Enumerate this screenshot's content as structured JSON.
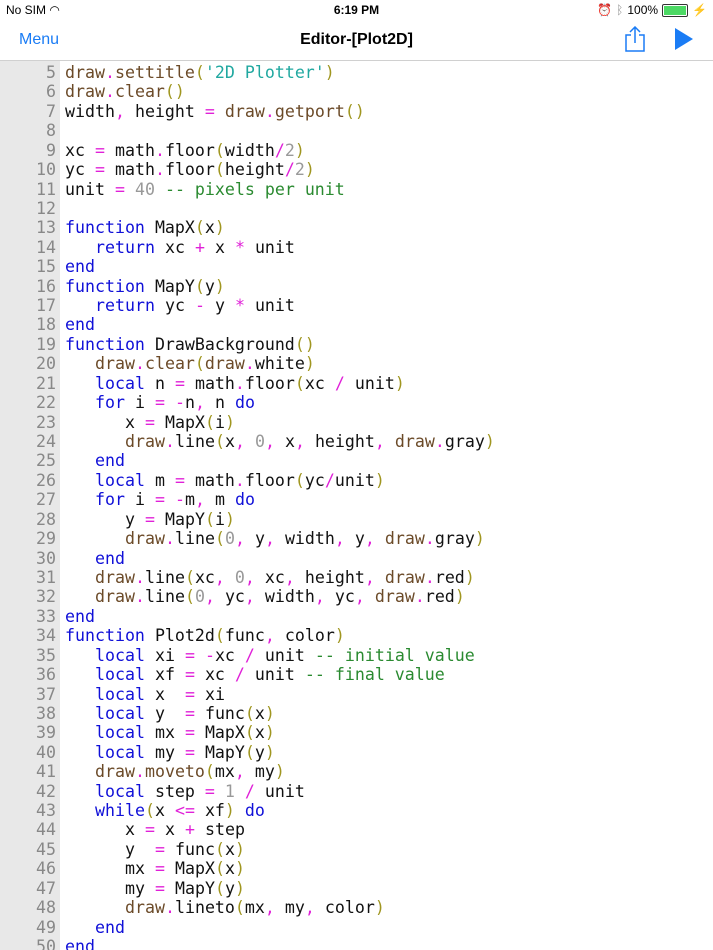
{
  "status": {
    "carrier": "No SIM",
    "time": "6:19 PM",
    "battery": "100%",
    "battery_level": 1.0
  },
  "nav": {
    "menu_label": "Menu",
    "title": "Editor-[Plot2D]"
  },
  "editor": {
    "first_line": 5,
    "lines": [
      "draw.settitle('2D Plotter')",
      "draw.clear()",
      "width, height = draw.getport()",
      "",
      "xc = math.floor(width/2)",
      "yc = math.floor(height/2)",
      "unit = 40 -- pixels per unit",
      "",
      "function MapX(x)",
      "   return xc + x * unit",
      "end",
      "function MapY(y)",
      "   return yc - y * unit",
      "end",
      "function DrawBackground()",
      "   draw.clear(draw.white)",
      "   local n = math.floor(xc / unit)",
      "   for i = -n, n do",
      "      x = MapX(i)",
      "      draw.line(x, 0, x, height, draw.gray)",
      "   end",
      "   local m = math.floor(yc/unit)",
      "   for i = -m, m do",
      "      y = MapY(i)",
      "      draw.line(0, y, width, y, draw.gray)",
      "   end",
      "   draw.line(xc, 0, xc, height, draw.red)",
      "   draw.line(0, yc, width, yc, draw.red)",
      "end",
      "function Plot2d(func, color)",
      "   local xi = -xc / unit -- initial value",
      "   local xf = xc / unit -- final value",
      "   local x  = xi",
      "   local y  = func(x)",
      "   local mx = MapX(x)",
      "   local my = MapY(y)",
      "   draw.moveto(mx, my)",
      "   local step = 1 / unit",
      "   while(x <= xf) do",
      "      x = x + step",
      "      y  = func(x)",
      "      mx = MapX(x)",
      "      my = MapY(y)",
      "      draw.lineto(mx, my, color)",
      "   end",
      "end"
    ]
  }
}
